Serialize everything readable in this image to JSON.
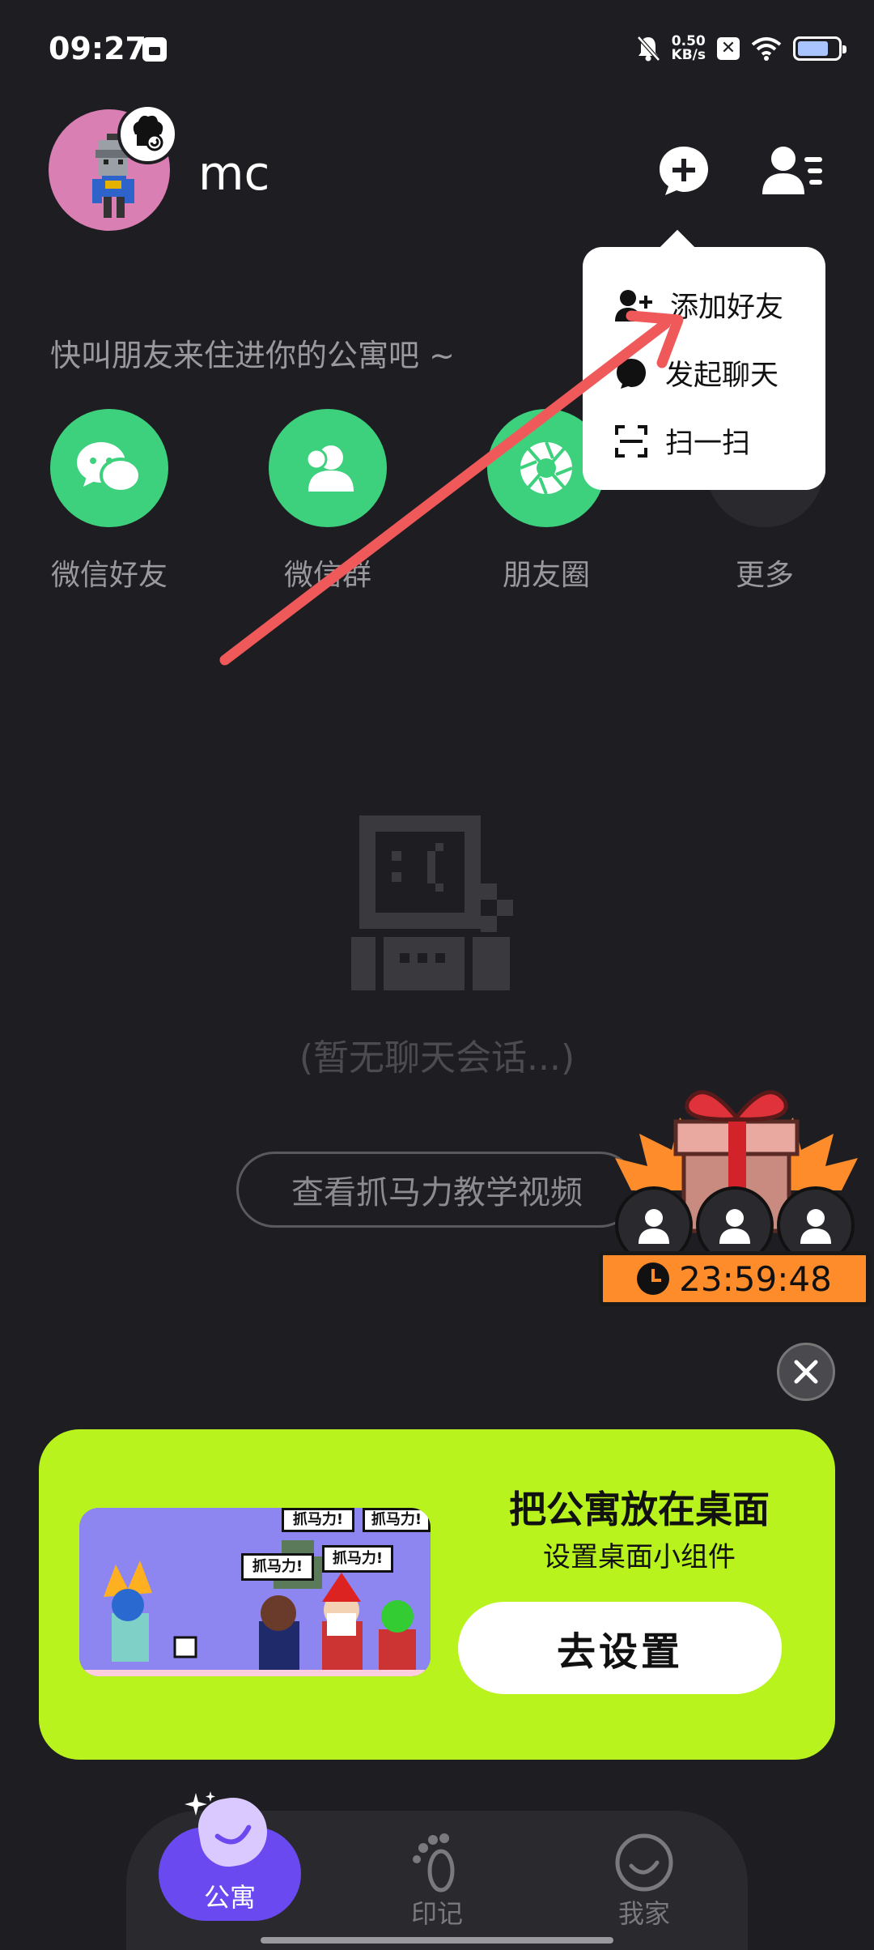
{
  "status_bar": {
    "time": "09:27",
    "net_speed_value": "0.50",
    "net_speed_unit": "KB/s",
    "badge": "✕"
  },
  "header": {
    "username": "mc"
  },
  "invite": {
    "text": "快叫朋友来住进你的公寓吧 ~",
    "options": [
      {
        "label": "微信好友",
        "icon": "wechat-icon"
      },
      {
        "label": "微信群",
        "icon": "wechat-group-icon"
      },
      {
        "label": "朋友圈",
        "icon": "moments-icon"
      },
      {
        "label": "更多",
        "icon": "more-icon"
      }
    ]
  },
  "dropdown": {
    "items": [
      {
        "label": "添加好友",
        "icon": "add-friend-icon"
      },
      {
        "label": "发起聊天",
        "icon": "chat-icon"
      },
      {
        "label": "扫一扫",
        "icon": "scan-icon"
      }
    ]
  },
  "empty_state": {
    "text": "(暂无聊天会话...)",
    "tutorial_button": "查看抓马力教学视频"
  },
  "gift_widget": {
    "timer": "23:59:48"
  },
  "promo": {
    "title": "把公寓放在桌面",
    "subtitle": "设置桌面小组件",
    "button": "去设置",
    "speech": [
      "抓马力!",
      "抓马力!",
      "抓马力!",
      "抓马力!"
    ]
  },
  "bottom_nav": {
    "items": [
      {
        "label": "公寓",
        "active": true
      },
      {
        "label": "印记",
        "active": false
      },
      {
        "label": "我家",
        "active": false
      }
    ]
  },
  "colors": {
    "background": "#1e1e22",
    "share_green": "#3dd17e",
    "promo_lime": "#b8f31d",
    "nav_active": "#6a4af0",
    "timer_orange": "#ff8c2a",
    "arrow_red": "#f0595a"
  }
}
